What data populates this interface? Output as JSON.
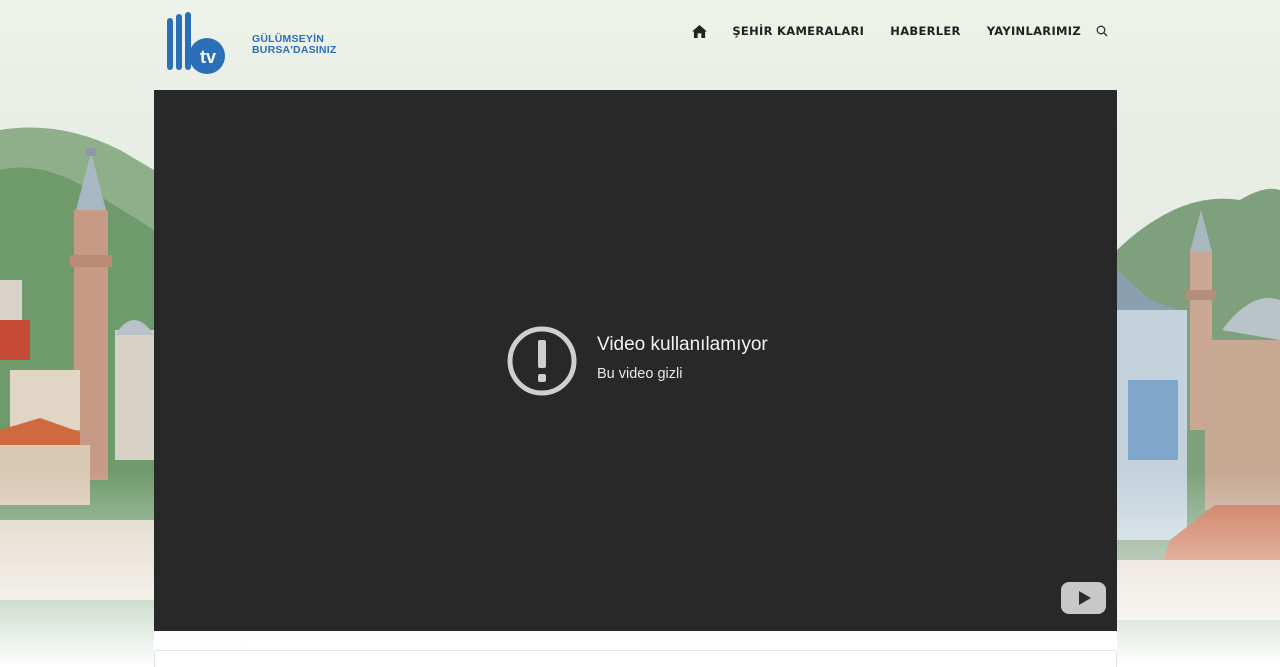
{
  "logo": {
    "mark_text": "tv",
    "line1": "GÜLÜMSEYİN",
    "line2": "BURSA'DASINIZ",
    "brand_color": "#2a6fb8"
  },
  "nav": {
    "home_icon": "home-icon",
    "items": [
      "ŞEHİR KAMERALARI",
      "HABERLER",
      "YAYINLARIMIZ"
    ],
    "search_icon": "search-icon"
  },
  "player": {
    "background": "#282828",
    "error_icon": "alert-circle-icon",
    "error_title": "Video kullanılamıyor",
    "error_subtitle": "Bu video gizli",
    "brand_icon": "youtube-play-icon"
  }
}
